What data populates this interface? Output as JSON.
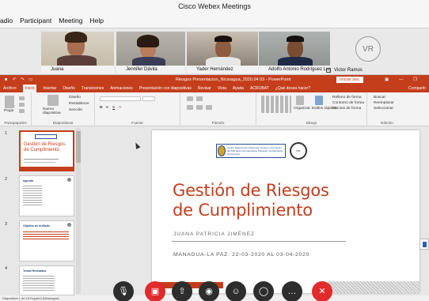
{
  "app": {
    "title": "Cisco Webex Meetings"
  },
  "menu": [
    "adio",
    "Participant",
    "Meeting",
    "Help"
  ],
  "participants": [
    {
      "name": "Juana"
    },
    {
      "name": "Jennifer Dávila"
    },
    {
      "name": "Yader Hernández"
    },
    {
      "name": "Adolfo Antonio Rodríguez Lugo"
    },
    {
      "name": "Victor Ramos",
      "initials": "VR"
    }
  ],
  "ppt": {
    "file_title": "Riesgos Presentacion_Nicaragua_2020.04.03 - PowerPoint",
    "signin": "Iniciar ses.",
    "tabs": [
      "Archivo",
      "Inicio",
      "Insertar",
      "Diseño",
      "Transiciones",
      "Animaciones",
      "Presentación con diapositivas",
      "Revisar",
      "Vista",
      "Ayuda",
      "ACROBAT",
      "¿Qué desea hacer?"
    ],
    "share_label": "Compartir",
    "ribbon": {
      "paste": "Pegar",
      "new_slide": "Nueva diapositiva",
      "design": "Diseño",
      "reset": "Restablecer",
      "section": "Sección",
      "organize": "Organizar",
      "quick_styles": "Estilos rápidos",
      "fill": "Relleno de forma",
      "outline": "Contorno de forma",
      "effects": "Efectos de forma",
      "find": "Buscar",
      "replace": "Reemplazar",
      "select": "Seleccionar",
      "groups": [
        "Portapapeles",
        "Diapositivas",
        "Fuente",
        "Párrafo",
        "Dibujo",
        "Edición"
      ]
    },
    "thumbnails": [
      {
        "num": "1",
        "title": "Gestión de Riesgos de Cumplimiento"
      },
      {
        "num": "2",
        "title": "Agenda"
      },
      {
        "num": "3",
        "title": "Objetivo de la tiltulle"
      },
      {
        "num": "4",
        "title": "Temas Revisados"
      }
    ],
    "slide": {
      "logo_text": "Centro Regional de Asistencia Técnica y Formación del FMI para Centroamérica, Panamá y la República Dominicana",
      "imf_text": "IMF",
      "title_line1": "Gestión de Riesgos",
      "title_line2": "de Cumplimiento",
      "author": "JUANA PATRICIA JIMÉNEZ",
      "date_line": "MANAGUA-LA PAZ: 22-03-2020 AL 03-04-2020"
    },
    "status": "Diapositiva 1 de 18    Español (Nicaragua)"
  },
  "controls": [
    {
      "name": "mute",
      "glyph": "🎙"
    },
    {
      "name": "video",
      "glyph": "▣"
    },
    {
      "name": "share",
      "glyph": "⇧"
    },
    {
      "name": "record",
      "glyph": "◉"
    },
    {
      "name": "participants",
      "glyph": "☺"
    },
    {
      "name": "chat",
      "glyph": "◯"
    },
    {
      "name": "more",
      "glyph": "…"
    },
    {
      "name": "leave",
      "glyph": "✕"
    }
  ]
}
